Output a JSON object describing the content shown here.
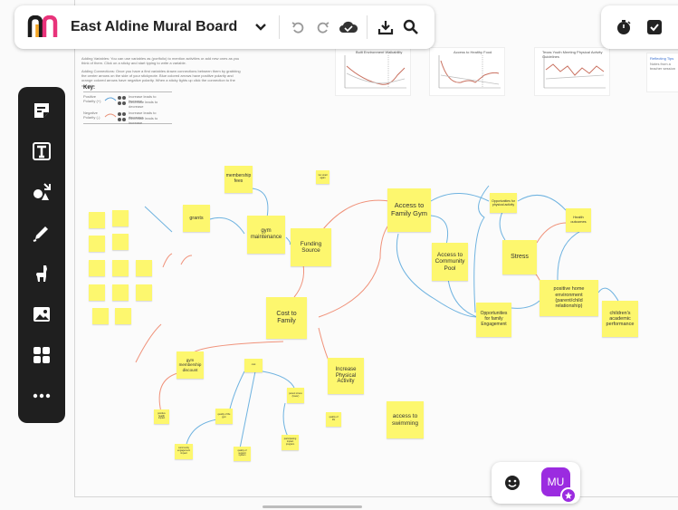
{
  "app": {
    "title": "East Aldine Mural Board",
    "logo_colors": [
      "#e8337a",
      "#1b1b1b"
    ]
  },
  "toolbar": {
    "icons": [
      "chevron-down-icon",
      "undo-icon",
      "redo-icon",
      "cloud-sync-icon",
      "download-icon",
      "search-icon"
    ]
  },
  "right_toolbar": {
    "icons": [
      "timer-icon",
      "checkbox-icon"
    ]
  },
  "left_tools": [
    "sticky-note-tool-icon",
    "text-tool-icon",
    "shapes-tool-icon",
    "pen-tool-icon",
    "llama-tool-icon",
    "image-tool-icon",
    "templates-tool-icon",
    "more-tool-icon"
  ],
  "doc": {
    "adding_variables": "Adding Variables: You can use variables as (portfolio) to mention activities or add new ones as you think of them. Click on a sticky and start typing to write a variable.",
    "adding_connections": "Adding Connections: Once you have a first variables drawn connections between them by grabbing the center arrows on the side of your stickynote. Blue colored arrows have positive polarity and orange colored arrows have negative polarity. When a sticky lights up click the connection to the variable.",
    "key_title": "Key:",
    "key_rows": [
      {
        "label": "Positive Polarity (+)",
        "desc1": "Increase leads to increase",
        "desc2": "Decrease leads to decrease"
      },
      {
        "label": "Negative Polarity (-)",
        "desc1": "Increase leads to decrease",
        "desc2": "Decrease leads to increase"
      }
    ]
  },
  "charts": [
    {
      "title": "Built Environment Walkability"
    },
    {
      "title": "Access to Healthy Food"
    },
    {
      "title": "Texas Youth Meeting Physical Activity Guidelines"
    }
  ],
  "aside_note": {
    "title": "Reflecting Tips",
    "body": "Notes from a teacher session"
  },
  "notes": {
    "membership_fees": "membership fees",
    "grants": "grants",
    "gym_maintenance": "gym maintenance",
    "small_note": "Go small again",
    "funding_source": "Funding Source",
    "access_family_gym": "Access to Family Gym",
    "opportunities_physical": "Opportunities for physical activity",
    "health_outcomes": "Health outcomes",
    "access_community_pool": "Access to Community Pool",
    "stress": "Stress",
    "positive_home": "positive home environment (parent/child relationship)",
    "opportunities_family": "Opportunities for family Engagement",
    "childrens_academic": "children's academic performance",
    "cost_to_family": "Cost to Family",
    "increase_physical": "Increase Physical Activity",
    "gym_membership_discount": "gym membership discount",
    "access_swimming": "access to swimming",
    "small_a": "cost",
    "small_b": "quality of life",
    "small_c": "parent stress (lower)",
    "small_d": "quality of life gym",
    "small_e": "community engagement impact",
    "small_f": "positive health impact",
    "small_g": "participating impact program",
    "small_h": "family members",
    "small_i": "quality of support system"
  },
  "bottom": {
    "avatar_initials": "MU",
    "emoji_icon": "smiley-icon"
  }
}
